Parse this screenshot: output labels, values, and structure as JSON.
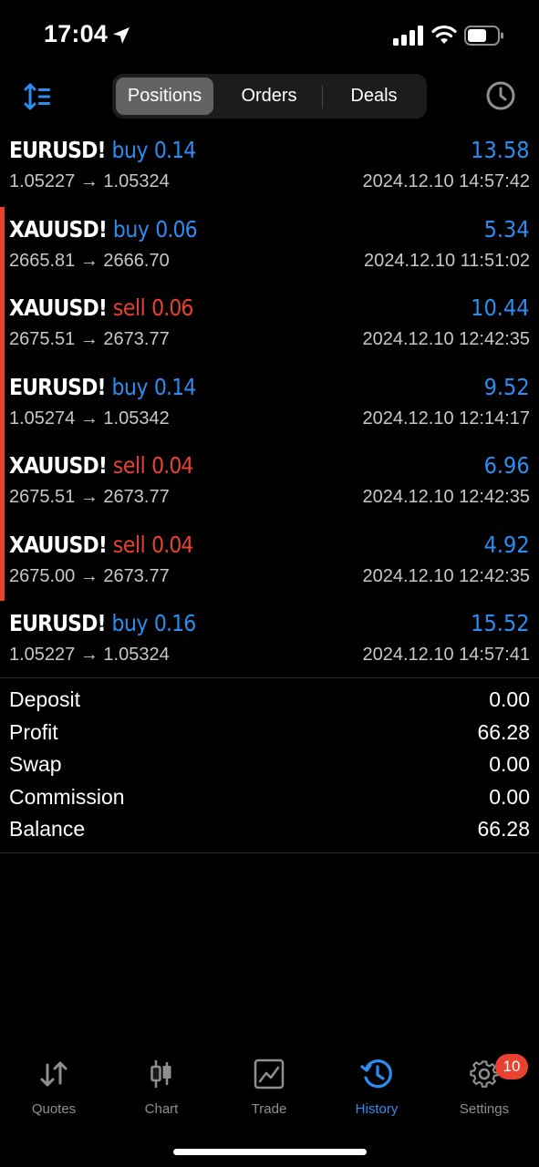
{
  "status_bar": {
    "time": "17:04"
  },
  "header": {
    "segments": {
      "positions": "Positions",
      "orders": "Orders",
      "deals": "Deals"
    },
    "active_segment": "Positions"
  },
  "trades": [
    {
      "symbol": "EURUSD!",
      "direction": "buy",
      "volume": "0.14",
      "profit": "13.58",
      "open_price": "1.05227",
      "close_price": "1.05324",
      "time": "2024.12.10 14:57:42",
      "active": false
    },
    {
      "symbol": "XAUUSD!",
      "direction": "buy",
      "volume": "0.06",
      "profit": "5.34",
      "open_price": "2665.81",
      "close_price": "2666.70",
      "time": "2024.12.10 11:51:02",
      "active": true
    },
    {
      "symbol": "XAUUSD!",
      "direction": "sell",
      "volume": "0.06",
      "profit": "10.44",
      "open_price": "2675.51",
      "close_price": "2673.77",
      "time": "2024.12.10 12:42:35",
      "active": true
    },
    {
      "symbol": "EURUSD!",
      "direction": "buy",
      "volume": "0.14",
      "profit": "9.52",
      "open_price": "1.05274",
      "close_price": "1.05342",
      "time": "2024.12.10 12:14:17",
      "active": true
    },
    {
      "symbol": "XAUUSD!",
      "direction": "sell",
      "volume": "0.04",
      "profit": "6.96",
      "open_price": "2675.51",
      "close_price": "2673.77",
      "time": "2024.12.10 12:42:35",
      "active": true
    },
    {
      "symbol": "XAUUSD!",
      "direction": "sell",
      "volume": "0.04",
      "profit": "4.92",
      "open_price": "2675.00",
      "close_price": "2673.77",
      "time": "2024.12.10 12:42:35",
      "active": true
    },
    {
      "symbol": "EURUSD!",
      "direction": "buy",
      "volume": "0.16",
      "profit": "15.52",
      "open_price": "1.05227",
      "close_price": "1.05324",
      "time": "2024.12.10 14:57:41",
      "active": false
    }
  ],
  "summary": [
    {
      "label": "Deposit",
      "value": "0.00"
    },
    {
      "label": "Profit",
      "value": "66.28"
    },
    {
      "label": "Swap",
      "value": "0.00"
    },
    {
      "label": "Commission",
      "value": "0.00"
    },
    {
      "label": "Balance",
      "value": "66.28"
    }
  ],
  "tabbar": {
    "tabs": [
      {
        "label": "Quotes",
        "icon": "quotes-arrows-icon"
      },
      {
        "label": "Chart",
        "icon": "candlestick-icon"
      },
      {
        "label": "Trade",
        "icon": "trade-chart-icon"
      },
      {
        "label": "History",
        "icon": "history-clock-icon"
      },
      {
        "label": "Settings",
        "icon": "gear-icon"
      }
    ],
    "active_tab": "History",
    "settings_badge": "10"
  },
  "colors": {
    "buy": "#2d8cf0",
    "sell": "#e8412f",
    "accent": "#2d8cf0",
    "background": "#000000"
  }
}
